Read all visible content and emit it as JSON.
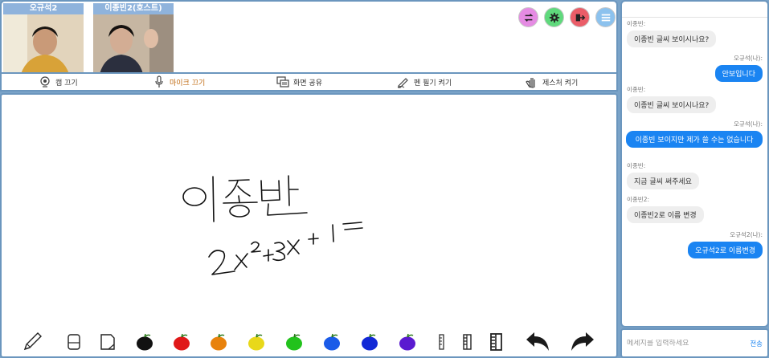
{
  "participants": [
    {
      "name": "오규석2"
    },
    {
      "name": "이종빈2(호스트)"
    }
  ],
  "header_buttons": [
    {
      "icon": "swap-icon",
      "color": "#e58be3"
    },
    {
      "icon": "gear-icon",
      "color": "#5fd97c"
    },
    {
      "icon": "exit-icon",
      "color": "#ea5d68"
    },
    {
      "icon": "menu-icon",
      "color": "#8cc2ee"
    }
  ],
  "controls": {
    "cam_label": "캠 끄기",
    "mic_label": "마이크 끄기",
    "share_label": "화면 공유",
    "pen_label": "펜 필기 켜기",
    "gesture_label": "제스처 켜기"
  },
  "toolbar": {
    "pen_colors": [
      "#111111",
      "#e01818",
      "#e8820c",
      "#e8d81a",
      "#22c21c",
      "#1a5be8",
      "#1228d6",
      "#5a1ad0"
    ],
    "thickness_levels": [
      "thin",
      "medium",
      "thick"
    ]
  },
  "chat": {
    "messages": [
      {
        "sender": "이종빈:",
        "text": "이종빈 글씨 보이시나요?",
        "mine": false
      },
      {
        "sender": "오규석(나):",
        "text": "안보입니다",
        "mine": true
      },
      {
        "sender": "이종빈:",
        "text": "이종빈 글씨 보이시나요?",
        "mine": false
      },
      {
        "sender": "오규석(나):",
        "text": "이종빈 보이지만 제가 쓸 수는 없습니다",
        "mine": true
      },
      {
        "sender": "이종빈:",
        "text": "지금 글씨 써주세요",
        "mine": false
      },
      {
        "sender": "이종빈2:",
        "text": "이종빈2로 이름 변경",
        "mine": false
      },
      {
        "sender": "오규석2(나):",
        "text": "오규석2로 이름변경",
        "mine": true
      }
    ],
    "input_placeholder": "메세지를 입력하세요",
    "send_label": "전송"
  }
}
